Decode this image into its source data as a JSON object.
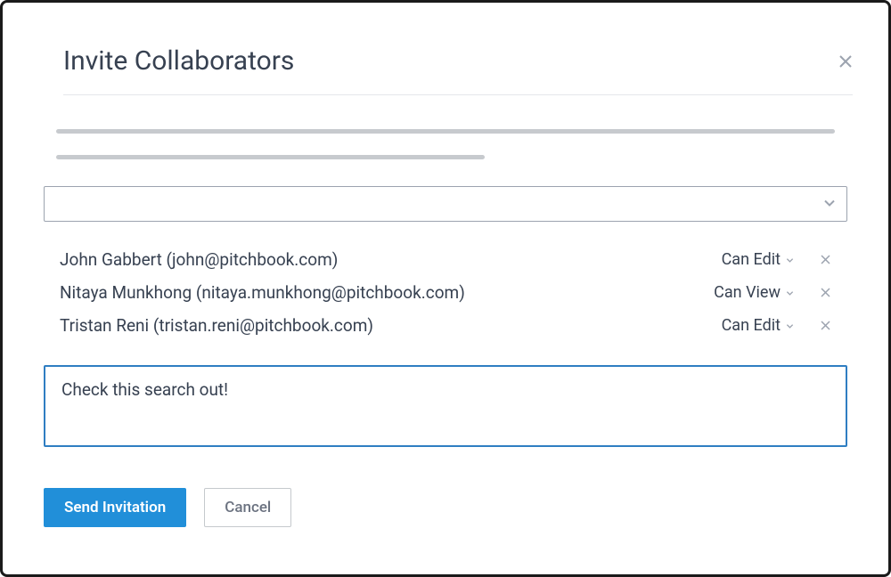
{
  "modal": {
    "title": "Invite Collaborators"
  },
  "collaborators": [
    {
      "displayText": "John Gabbert (john@pitchbook.com)",
      "permission": "Can Edit"
    },
    {
      "displayText": "Nitaya Munkhong (nitaya.munkhong@pitchbook.com)",
      "permission": "Can View"
    },
    {
      "displayText": "Tristan Reni (tristan.reni@pitchbook.com)",
      "permission": "Can Edit"
    }
  ],
  "message": {
    "value": "Check this search out!"
  },
  "buttons": {
    "send": "Send Invitation",
    "cancel": "Cancel"
  }
}
